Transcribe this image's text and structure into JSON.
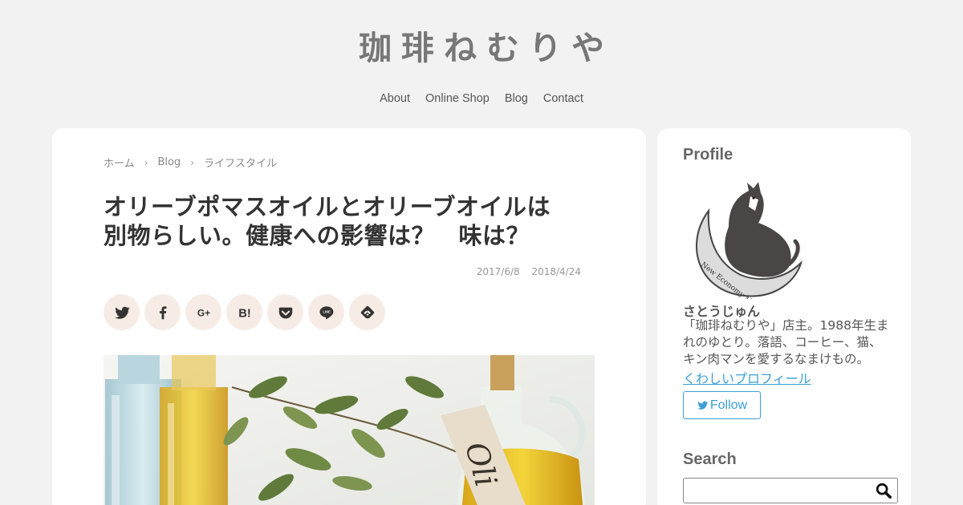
{
  "site": {
    "title": "珈琲ねむりや"
  },
  "nav": {
    "items": [
      "About",
      "Online Shop",
      "Blog",
      "Contact"
    ]
  },
  "breadcrumb": {
    "items": [
      "ホーム",
      "Blog",
      "ライフスタイル"
    ]
  },
  "post": {
    "title_line1": "オリーブポマスオイルとオリーブオイルは",
    "title_line2": "別物らしい。健康への影響は？　味は？",
    "published": "2017/6/8",
    "updated": "2018/4/24",
    "image_label": "Oli"
  },
  "share": {
    "buttons": [
      "twitter-icon",
      "facebook-icon",
      "google-plus-icon",
      "hatena-bookmark-icon",
      "pocket-icon",
      "line-icon",
      "feedly-icon"
    ],
    "hatena_text": "B!",
    "gplus_text": "G+",
    "line_text": "LINE"
  },
  "sidebar": {
    "profile_title": "Profile",
    "avatar_caption": "New Economy Movement ...",
    "author_name": "さとうじゅん",
    "bio_line1": "「珈琲ねむりや」店主。1988年生ま",
    "bio_line2": "れのゆとり。落語、コーヒー、猫、",
    "bio_line3": "キン肉マンを愛するなまけもの。",
    "profile_link": "くわしいプロフィール",
    "follow_label": "Follow",
    "search_title": "Search",
    "search_value": ""
  },
  "colors": {
    "background": "#f2f2f2",
    "card": "#ffffff",
    "share_bg": "#f6ece5",
    "link": "#3a9fd6",
    "title_text": "#777777"
  }
}
